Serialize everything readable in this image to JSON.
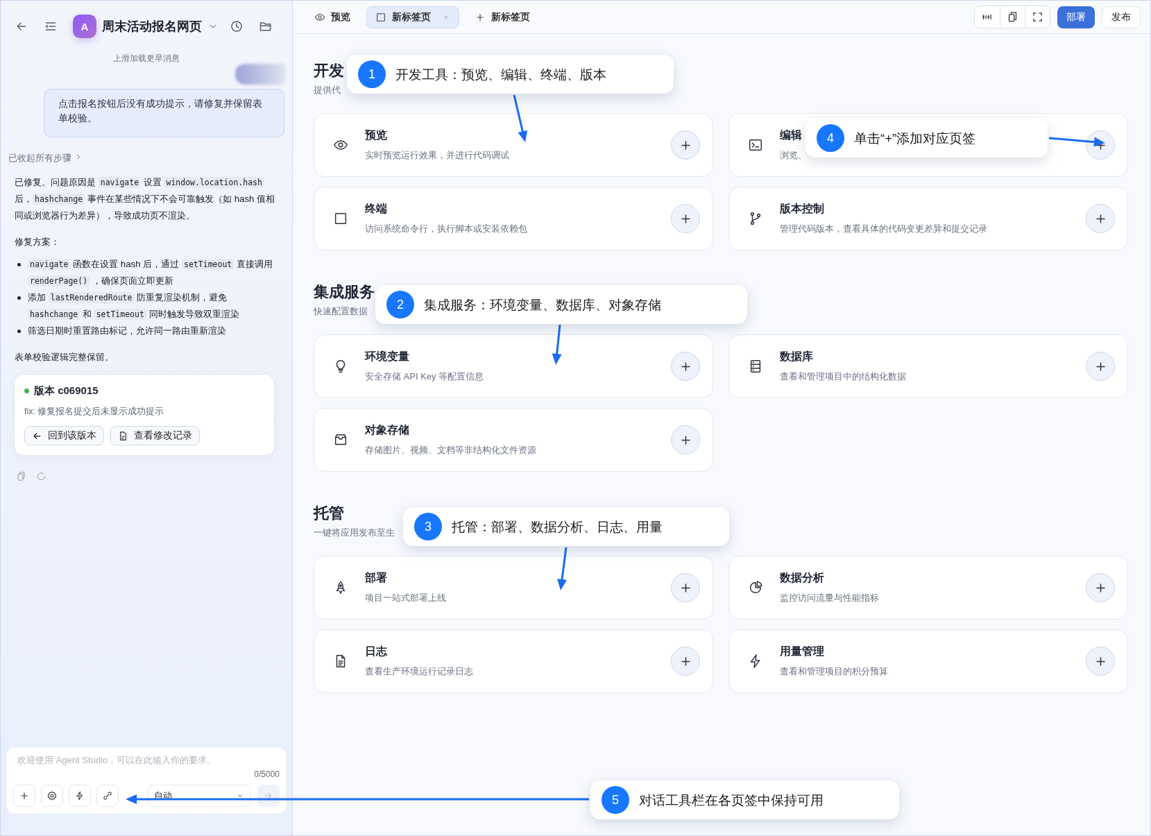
{
  "project": {
    "avatar_letter": "A",
    "title": "周末活动报名网页"
  },
  "chat": {
    "load_more": "上滑加载更早消息",
    "user_message": "点击报名按钮后没有成功提示，请修复并保留表单校验。",
    "steps_toggle": "已收起所有步骤",
    "paragraphs_before": [
      [
        {
          "text": "已修复。问题原因是 ",
          "kind": "text"
        },
        {
          "text": "navigate",
          "kind": "code"
        },
        {
          "text": " 设置 ",
          "kind": "text"
        },
        {
          "text": "window.location.hash",
          "kind": "code"
        },
        {
          "text": " 后，",
          "kind": "text"
        },
        {
          "text": "hashchange",
          "kind": "code"
        },
        {
          "text": " 事件在某些情况下不会可靠触发（如 hash 值相同或浏览器行为差异），导致成功页不渲染。",
          "kind": "text"
        }
      ],
      [
        {
          "text": "修复方案：",
          "kind": "text"
        }
      ]
    ],
    "bullets": [
      [
        {
          "text": "navigate",
          "kind": "code"
        },
        {
          "text": " 函数在设置 hash 后，通过 ",
          "kind": "text"
        },
        {
          "text": "setTimeout",
          "kind": "code"
        },
        {
          "text": " 直接调用 ",
          "kind": "text"
        },
        {
          "text": "renderPage()",
          "kind": "code"
        },
        {
          "text": " ，确保页面立即更新",
          "kind": "text"
        }
      ],
      [
        {
          "text": "添加 ",
          "kind": "text"
        },
        {
          "text": "lastRenderedRoute",
          "kind": "code"
        },
        {
          "text": " 防重复渲染机制，避免 ",
          "kind": "text"
        },
        {
          "text": "hashchange",
          "kind": "code"
        },
        {
          "text": " 和 ",
          "kind": "text"
        },
        {
          "text": "setTimeout",
          "kind": "code"
        },
        {
          "text": " 同时触发导致双重渲染",
          "kind": "text"
        }
      ],
      [
        {
          "text": "筛选日期时重置路由标记，允许同一路由重新渲染",
          "kind": "text"
        }
      ]
    ],
    "paragraphs_after": [
      [
        {
          "text": "表单校验逻辑完整保留。",
          "kind": "text"
        }
      ]
    ],
    "version": {
      "color": "#4caf50",
      "title": "版本 c069015",
      "message": "fix: 修复报名提交后未显示成功提示",
      "buttons": [
        "回到该版本",
        "查看修改记录"
      ]
    }
  },
  "composer": {
    "placeholder": "欢迎使用 Agent Studio，可以在此输入你的要求。",
    "counter": "0/5000",
    "mode": "自动",
    "send_disabled": true
  },
  "tabs": [
    {
      "label": "预览",
      "selected": false,
      "closable": false
    },
    {
      "label": "新标签页",
      "selected": true,
      "closable": true
    }
  ],
  "new_tab": "新标签页",
  "actions": {
    "deploy": "部署",
    "publish": "发布"
  },
  "sections": [
    {
      "title": "开发",
      "subtitle": "提供代",
      "cards": [
        {
          "title": "预览",
          "description": "实时预览运行效果，并进行代码调试"
        },
        {
          "title": "编辑",
          "description": "浏览、"
        },
        {
          "title": "终端",
          "description": "访问系统命令行，执行脚本或安装依赖包"
        },
        {
          "title": "版本控制",
          "description": "管理代码版本，查看具体的代码变更差异和提交记录"
        }
      ]
    },
    {
      "title": "集成服务",
      "subtitle": "快速配置数据",
      "cards": [
        {
          "title": "环境变量",
          "description": "安全存储 API Key 等配置信息"
        },
        {
          "title": "数据库",
          "description": "查看和管理项目中的结构化数据"
        },
        {
          "title": "对象存储",
          "description": "存储图片、视频、文档等非结构化文件资源"
        }
      ]
    },
    {
      "title": "托管",
      "subtitle": "一键将应用发布至生",
      "cards": [
        {
          "title": "部署",
          "description": "项目一站式部署上线"
        },
        {
          "title": "数据分析",
          "description": "监控访问流量与性能指标"
        },
        {
          "title": "日志",
          "description": "查看生产环境运行记录日志"
        },
        {
          "title": "用量管理",
          "description": "查看和管理项目的积分预算"
        }
      ]
    }
  ],
  "annotations": [
    {
      "number": "1",
      "text": "开发工具：预览、编辑、终端、版本"
    },
    {
      "number": "4",
      "text": "单击“+”添加对应页签"
    },
    {
      "number": "2",
      "text": "集成服务：环境变量、数据库、对象存储"
    },
    {
      "number": "3",
      "text": "托管：部署、数据分析、日志、用量"
    },
    {
      "number": "5",
      "text": "对话工具栏在各页签中保持可用"
    }
  ]
}
